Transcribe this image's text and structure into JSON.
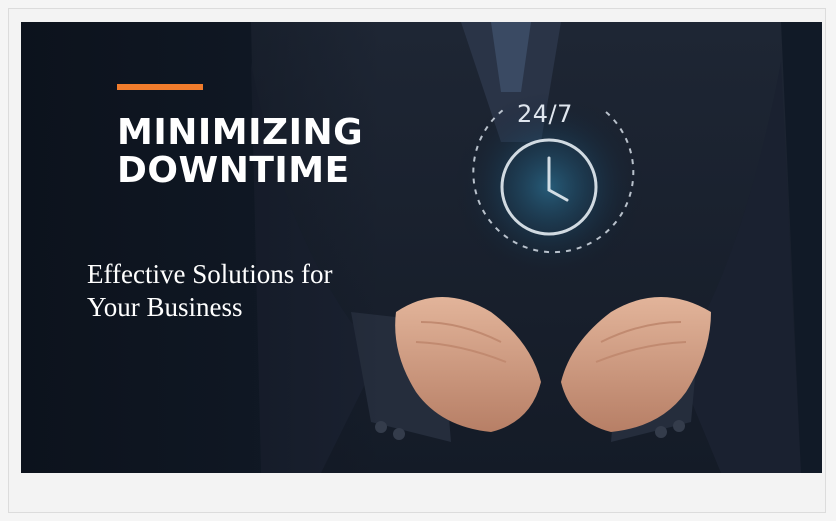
{
  "slide": {
    "title_line1": "MINIMIZING",
    "title_line2": "DOWNTIME",
    "subtitle_line1": "Effective Solutions for",
    "subtitle_line2": "Your Business",
    "badge_text": "24/7"
  },
  "colors": {
    "accent": "#f07c2c",
    "background": "#0f1724",
    "text": "#ffffff"
  }
}
